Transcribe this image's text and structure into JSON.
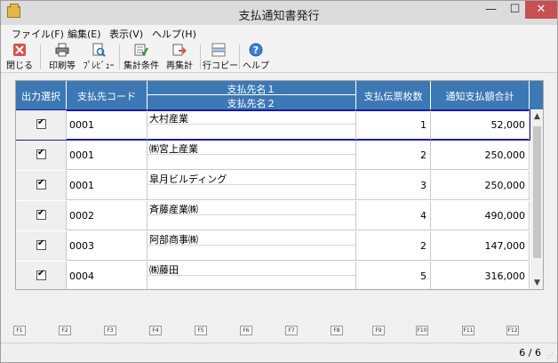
{
  "window": {
    "title": "支払通知書発行",
    "controls": {
      "minimize": "—",
      "maximize": "☐",
      "close": "✕"
    }
  },
  "menu": [
    "ファイル(F)",
    "編集(E)",
    "表示(V)",
    "ヘルプ(H)"
  ],
  "toolbar": {
    "close": "閉じる",
    "print": "印刷等",
    "preview": "ﾌﾟﾚﾋﾞｭｰ",
    "criteria": "集計条件",
    "recalc": "再集計",
    "rowcopy": "行コピー",
    "help": "ヘルプ"
  },
  "table": {
    "headers": {
      "select": "出力選択",
      "code": "支払先コード",
      "name1": "支払先名１",
      "name2": "支払先名２",
      "count": "支払伝票枚数",
      "amount": "通知支払額合計"
    },
    "rows": [
      {
        "checked": true,
        "code": "0001",
        "name1": "大村産業",
        "name2": "",
        "count": "1",
        "amount": "52,000"
      },
      {
        "checked": true,
        "code": "0001",
        "name1": "㈱宮上産業",
        "name2": "",
        "count": "2",
        "amount": "250,000"
      },
      {
        "checked": true,
        "code": "0001",
        "name1": "皐月ビルディング",
        "name2": "",
        "count": "3",
        "amount": "250,000"
      },
      {
        "checked": true,
        "code": "0002",
        "name1": "斉藤産業㈱",
        "name2": "",
        "count": "4",
        "amount": "490,000"
      },
      {
        "checked": true,
        "code": "0003",
        "name1": "阿部商事㈱",
        "name2": "",
        "count": "2",
        "amount": "147,000"
      },
      {
        "checked": true,
        "code": "0004",
        "name1": "㈱藤田",
        "name2": "",
        "count": "5",
        "amount": "316,000"
      }
    ]
  },
  "scroll": {
    "up": "▲",
    "down": "▼"
  },
  "function_keys": [
    "F1",
    "F2",
    "F3",
    "F4",
    "F5",
    "F6",
    "F7",
    "F8",
    "F9",
    "F10",
    "F11",
    "F12"
  ],
  "status": {
    "page_count": "6 / 6"
  },
  "colors": {
    "header_bg": "#3c78b4",
    "selection": "#1a1aa8",
    "close_btn": "#c75050"
  }
}
